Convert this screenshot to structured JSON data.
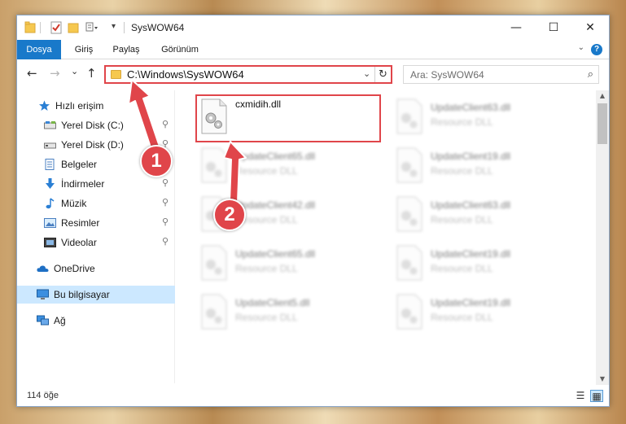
{
  "window": {
    "title": "SysWOW64",
    "controls": {
      "minimize": "—",
      "maximize": "☐",
      "close": "✕"
    }
  },
  "ribbon": {
    "tabs": [
      {
        "label": "Dosya",
        "active": true
      },
      {
        "label": "Giriş"
      },
      {
        "label": "Paylaş"
      },
      {
        "label": "Görünüm"
      }
    ],
    "help_label": "?"
  },
  "nav": {
    "back": "←",
    "forward": "→",
    "recent": "⌄",
    "up": "↑",
    "address": "C:\\Windows\\SysWOW64",
    "refresh": "↻",
    "search_placeholder": "Ara: SysWOW64"
  },
  "sidebar": {
    "items": [
      {
        "label": "Hızlı erişim",
        "icon": "star-icon"
      },
      {
        "label": "Yerel Disk (C:)",
        "icon": "drive-icon",
        "pinned": true
      },
      {
        "label": "Yerel Disk (D:)",
        "icon": "drive-icon",
        "pinned": true
      },
      {
        "label": "Belgeler",
        "icon": "documents-icon",
        "pinned": true
      },
      {
        "label": "İndirmeler",
        "icon": "download-icon",
        "pinned": true
      },
      {
        "label": "Müzik",
        "icon": "music-icon",
        "pinned": true
      },
      {
        "label": "Resimler",
        "icon": "pictures-icon",
        "pinned": true
      },
      {
        "label": "Videolar",
        "icon": "video-icon",
        "pinned": true
      },
      {
        "label": "OneDrive",
        "icon": "cloud-icon"
      },
      {
        "label": "Bu bilgisayar",
        "icon": "computer-icon",
        "selected": true
      },
      {
        "label": "Ağ",
        "icon": "network-icon"
      }
    ],
    "pin_glyph": "📌"
  },
  "files": [
    {
      "name": "cxmidih.dll",
      "type": ""
    },
    {
      "name": "UpdateClient63.dll",
      "type": "Resource DLL"
    },
    {
      "name": "UpdateClient65.dll",
      "type": "Resource DLL"
    },
    {
      "name": "UpdateClient19.dll",
      "type": "Resource DLL"
    },
    {
      "name": "UpdateClient42.dll",
      "type": "Resource DLL"
    },
    {
      "name": "UpdateClient63.dll",
      "type": "Resource DLL"
    },
    {
      "name": "UpdateClient65.dll",
      "type": "Resource DLL"
    },
    {
      "name": "UpdateClient19.dll",
      "type": "Resource DLL"
    },
    {
      "name": "UpdateClient5.dll",
      "type": "Resource DLL"
    },
    {
      "name": "UpdateClient19.dll",
      "type": "Resource DLL"
    }
  ],
  "status": {
    "count": "114 öğe"
  },
  "annotations": {
    "step1": "1",
    "step2": "2",
    "color": "#e0454a"
  }
}
